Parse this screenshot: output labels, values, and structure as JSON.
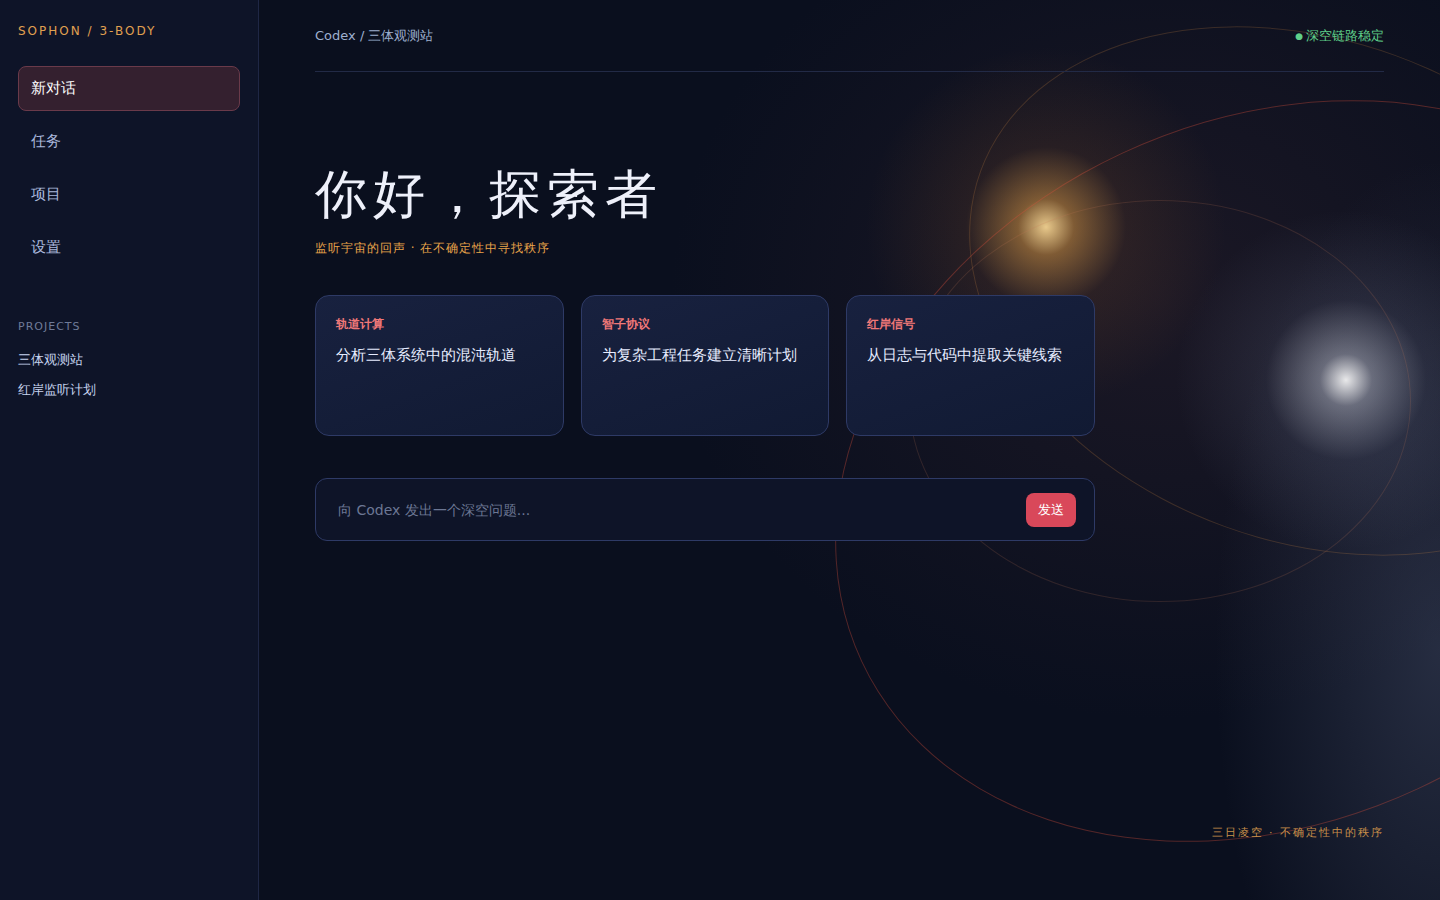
{
  "brand": "SOPHON / 3-BODY",
  "nav": [
    {
      "label": "新对话",
      "selected": true
    },
    {
      "label": "任务",
      "selected": false
    },
    {
      "label": "项目",
      "selected": false
    },
    {
      "label": "设置",
      "selected": false
    }
  ],
  "projects": {
    "heading": "PROJECTS",
    "items": [
      "三体观测站",
      "红岸监听计划"
    ]
  },
  "breadcrumb": "Codex / 三体观测站",
  "status": {
    "dot": "●",
    "label": "深空链路稳定"
  },
  "hero": {
    "title": "你好，探索者",
    "subtitle": "监听宇宙的回声 · 在不确定性中寻找秩序"
  },
  "cards": [
    {
      "tag": "轨道计算",
      "text": "分析三体系统中的混沌轨道"
    },
    {
      "tag": "智子协议",
      "text": "为复杂工程任务建立清晰计划"
    },
    {
      "tag": "红岸信号",
      "text": "从日志与代码中提取关键线索"
    }
  ],
  "composer": {
    "placeholder": "向 Codex 发出一个深空问题...",
    "button": "发送"
  },
  "footer": "三日凌空 · 不确定性中的秩序"
}
